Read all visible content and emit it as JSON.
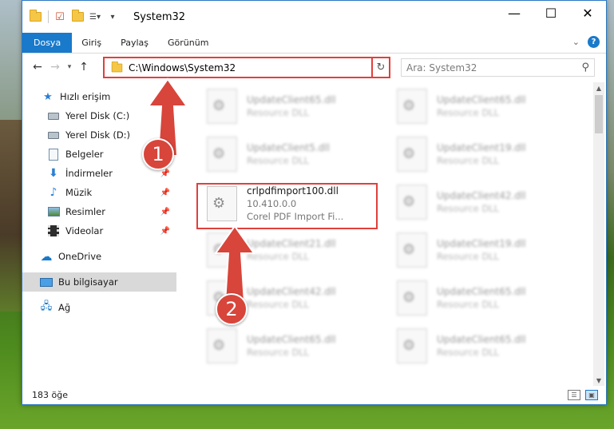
{
  "window": {
    "title": "System32"
  },
  "ribbon": {
    "tabs": [
      "Dosya",
      "Giriş",
      "Paylaş",
      "Görünüm"
    ],
    "help": "?"
  },
  "address": {
    "path": "C:\\Windows\\System32",
    "search_placeholder": "Ara: System32"
  },
  "nav": {
    "quick_access": "Hızlı erişim",
    "items": [
      {
        "label": "Yerel Disk (C:)",
        "icon": "drive-icon"
      },
      {
        "label": "Yerel Disk (D:)",
        "icon": "drive-icon"
      },
      {
        "label": "Belgeler",
        "icon": "documents-icon"
      },
      {
        "label": "İndirmeler",
        "icon": "downloads-icon"
      },
      {
        "label": "Müzik",
        "icon": "music-icon"
      },
      {
        "label": "Resimler",
        "icon": "pictures-icon"
      },
      {
        "label": "Videolar",
        "icon": "videos-icon"
      }
    ],
    "onedrive": "OneDrive",
    "this_pc": "Bu bilgisayar",
    "network": "Ağ"
  },
  "files": {
    "highlighted": {
      "name": "crlpdfimport100.dll",
      "version": "10.410.0.0",
      "description": "Corel PDF Import Fi..."
    },
    "left_column": [
      {
        "name": "UpdateClient65.dll",
        "desc": "Resource DLL"
      },
      {
        "name": "UpdateClient5.dll",
        "desc": "Resource DLL"
      },
      {
        "name": "UpdateClient21.dll",
        "desc": "Resource DLL"
      },
      {
        "name": "UpdateClient42.dll",
        "desc": "Resource DLL"
      },
      {
        "name": "UpdateClient65.dll",
        "desc": "Resource DLL"
      }
    ],
    "right_column": [
      {
        "name": "UpdateClient65.dll",
        "desc": "Resource DLL"
      },
      {
        "name": "UpdateClient19.dll",
        "desc": "Resource DLL"
      },
      {
        "name": "UpdateClient42.dll",
        "desc": "Resource DLL"
      },
      {
        "name": "UpdateClient19.dll",
        "desc": "Resource DLL"
      },
      {
        "name": "UpdateClient65.dll",
        "desc": "Resource DLL"
      },
      {
        "name": "UpdateClient65.dll",
        "desc": "Resource DLL"
      }
    ]
  },
  "status": {
    "item_count": "183 öğe"
  },
  "annotations": {
    "step1": "1",
    "step2": "2",
    "color": "#d8453b"
  }
}
